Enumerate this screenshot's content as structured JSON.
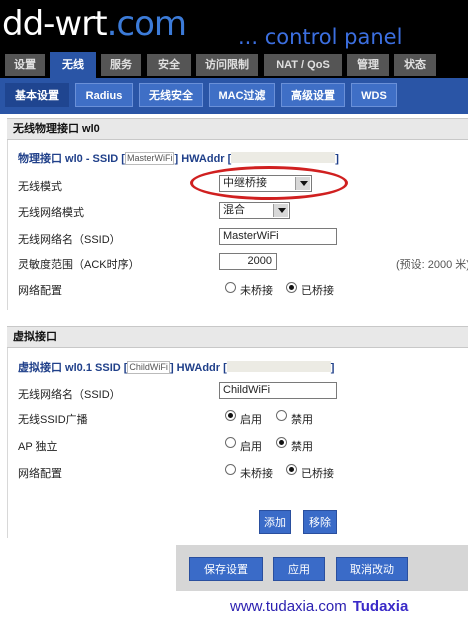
{
  "header": {
    "logo": "dd-wrt",
    "logo_suffix": ".com",
    "subtitle": "... control panel"
  },
  "tabs": [
    "设置",
    "无线",
    "服务",
    "安全",
    "访问限制",
    "NAT / QoS",
    "管理",
    "状态"
  ],
  "subtabs": [
    "基本设置",
    "Radius",
    "无线安全",
    "MAC过滤",
    "高级设置",
    "WDS"
  ],
  "physical": {
    "section_title": "无线物理接口 wl0",
    "legend_prefix": "物理接口 wl0 - SSID [",
    "legend_ssid": "MasterWiFi",
    "legend_suffix": "] HWAddr [",
    "legend_end": "]",
    "mode_label": "无线模式",
    "mode_value": "中继桥接",
    "netmode_label": "无线网络模式",
    "netmode_value": "混合",
    "ssid_label": "无线网络名（SSID）",
    "ssid_value": "MasterWiFi",
    "ack_label": "灵敏度范围（ACK时序）",
    "ack_value": "2000",
    "ack_hint": "(预设: 2000 米)",
    "netconf_label": "网络配置",
    "unbridged": "未桥接",
    "bridged": "已桥接"
  },
  "virtual": {
    "section_title": "虚拟接口",
    "legend_prefix": "虚拟接口 wl0.1 SSID [",
    "legend_ssid": "ChildWiFi",
    "legend_suffix": "] HWAddr [",
    "legend_end": "]",
    "ssid_label": "无线网络名（SSID）",
    "ssid_value": "ChildWiFi",
    "broadcast_label": "无线SSID广播",
    "enable": "启用",
    "disable": "禁用",
    "ap_label": "AP 独立",
    "netconf_label": "网络配置",
    "unbridged": "未桥接",
    "bridged": "已桥接",
    "add_button": "添加",
    "remove_button": "移除"
  },
  "footer": {
    "save": "保存设置",
    "apply": "应用",
    "cancel": "取消改动"
  },
  "watermark": {
    "url": "www.tudaxia.com",
    "brand": "Tudaxia"
  },
  "colors": {
    "accent": "#2a55a6",
    "highlight_ellipse": "#d02020"
  }
}
